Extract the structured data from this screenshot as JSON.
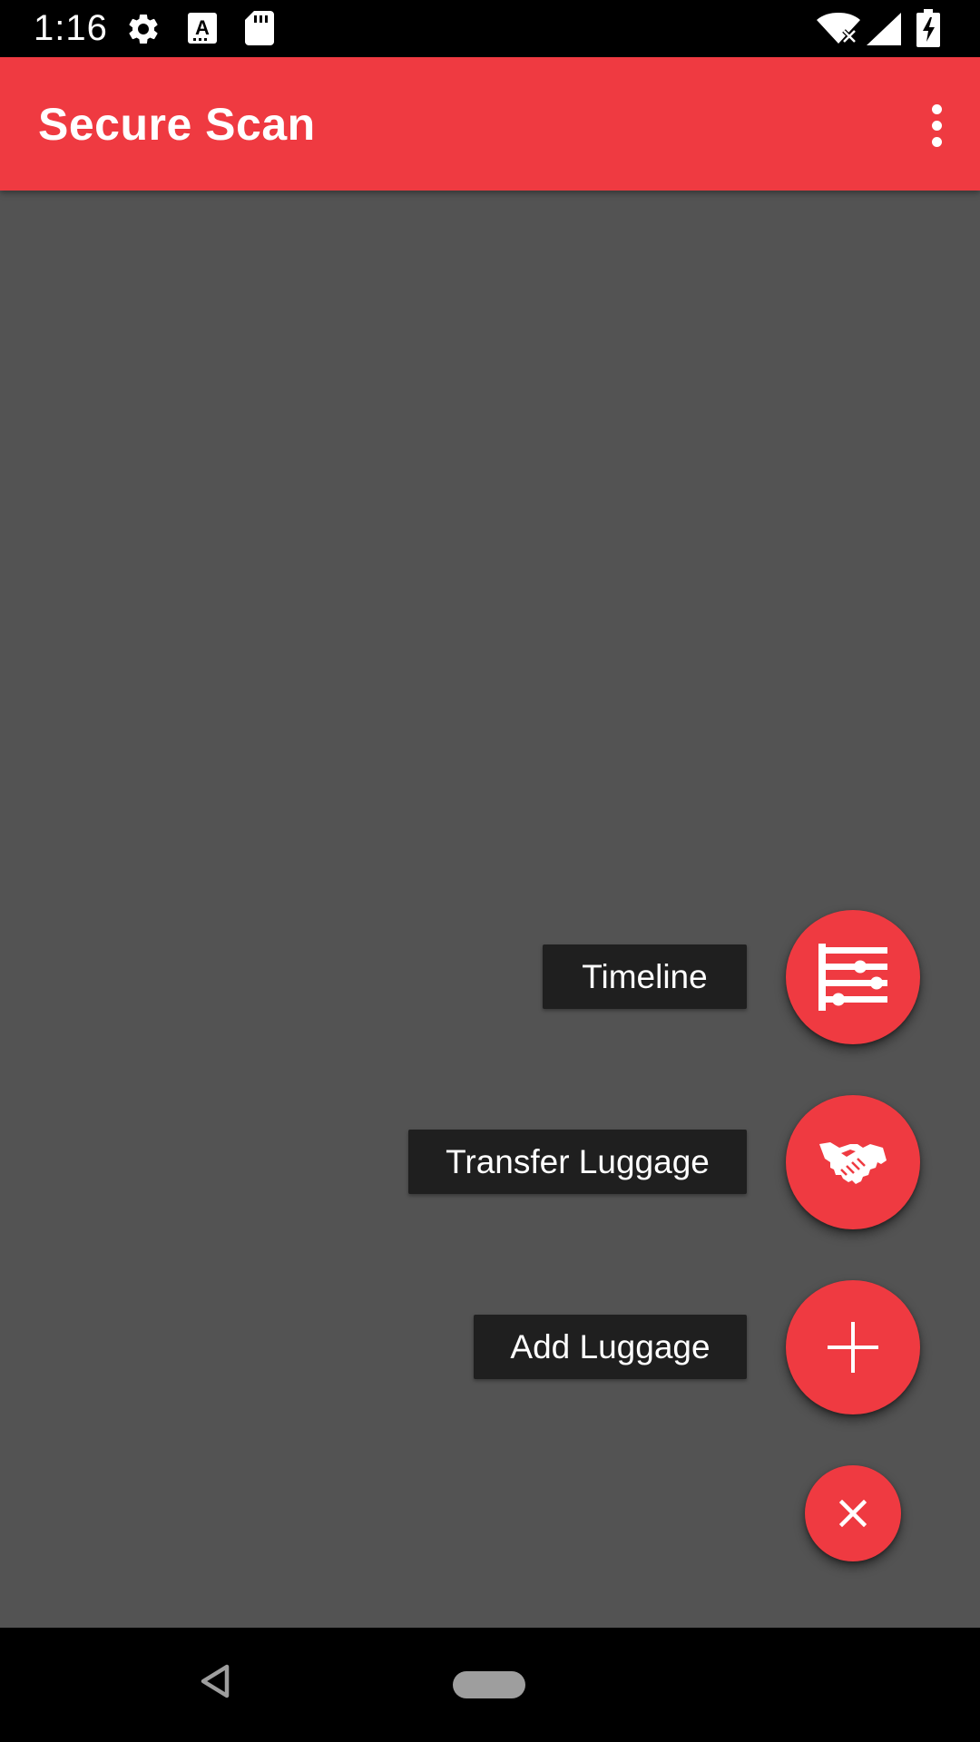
{
  "status_bar": {
    "time": "1:16",
    "icons": [
      "settings-icon",
      "keyboard-a-icon",
      "sd-card-icon",
      "wifi-off-icon",
      "cell-signal-icon",
      "battery-charging-icon"
    ]
  },
  "app_bar": {
    "title": "Secure Scan",
    "menu_icon": "more-vert-icon",
    "background": "#ef3a41"
  },
  "content": {
    "scrim_color": "#535353"
  },
  "speed_dial": {
    "actions": [
      {
        "label": "Timeline",
        "icon": "timeline-icon"
      },
      {
        "label": "Transfer Luggage",
        "icon": "handshake-icon"
      },
      {
        "label": "Add Luggage",
        "icon": "plus-icon"
      }
    ],
    "close_icon": "close-icon",
    "fab_color": "#ef3a41",
    "label_color": "#1f1f1f"
  },
  "nav_bar": {
    "icons": [
      "back-icon",
      "home-pill-icon"
    ]
  }
}
